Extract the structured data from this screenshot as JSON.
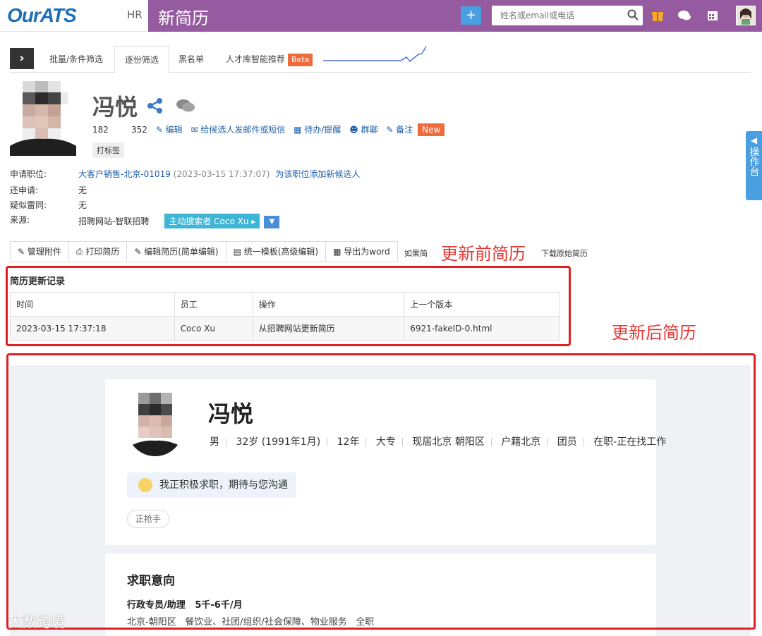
{
  "app": {
    "logo": "OurATS",
    "role": "HR",
    "page_title": "新简历"
  },
  "header": {
    "search_placeholder": "姓名或email或电话",
    "icons": [
      "plus-icon",
      "search-icon",
      "gift-icon",
      "chat-icon",
      "calendar-icon",
      "user-avatar"
    ]
  },
  "tabs": [
    {
      "label": "批量/条件筛选",
      "active": false
    },
    {
      "label": "逐份筛选",
      "active": true
    },
    {
      "label": "黑名单",
      "active": false
    },
    {
      "label": "人才库智能推荐",
      "active": false,
      "badge": "Beta"
    }
  ],
  "candidate": {
    "name": "冯悦",
    "stat1": "182",
    "stat2": "352",
    "actions": {
      "edit": "编辑",
      "mail": "给候选人发邮件或短信",
      "todo": "待办/提醒",
      "group": "群聊",
      "note": "备注",
      "new_badge": "New"
    },
    "tag_button": "打标签"
  },
  "info": {
    "position_label": "申请职位:",
    "position_value": "大客户销售-北京-01019",
    "position_time": "(2023-03-15 17:37:07)",
    "position_add": "为该职位添加新候选人",
    "also_label": "还申请:",
    "also_value": "无",
    "dup_label": "疑似雷同:",
    "dup_value": "无",
    "source_label": "来源:",
    "source_value": "招聘网站-智联招聘",
    "source_button": "主动搜索者 Coco Xu"
  },
  "toolbar": {
    "attachments": "管理附件",
    "print": "打印简历",
    "edit_simple": "编辑简历(简单编辑)",
    "template": "统一模板(高级编辑)",
    "export": "导出为word",
    "if_text": "如果简",
    "download": "下载原始简历"
  },
  "annotations": {
    "before": "更新前简历",
    "after": "更新后简历"
  },
  "history": {
    "title": "简历更新记录",
    "headers": [
      "时间",
      "员工",
      "操作",
      "上一个版本"
    ],
    "rows": [
      [
        "2023-03-15 17:37:18",
        "Coco Xu",
        "从招聘网站更新简历",
        "6921-fakeID-0.html"
      ]
    ]
  },
  "resume": {
    "name": "冯悦",
    "meta": [
      "男",
      "32岁 (1991年1月)",
      "12年",
      "大专",
      "现居北京 朝阳区",
      "户籍北京",
      "团员",
      "在职-正在找工作"
    ],
    "status_bubble": "我正积极求职，期待与您沟通",
    "tag": "正抢手",
    "intent_title": "求职意向",
    "job_title": "行政专员/助理",
    "salary": "5千-6千/月",
    "locations": [
      "北京-朝阳区",
      "餐饮业、社团/组织/社会保障、物业服务",
      "全职"
    ]
  },
  "side_panel": {
    "label": "操作台"
  },
  "watermark": "大数跨境"
}
